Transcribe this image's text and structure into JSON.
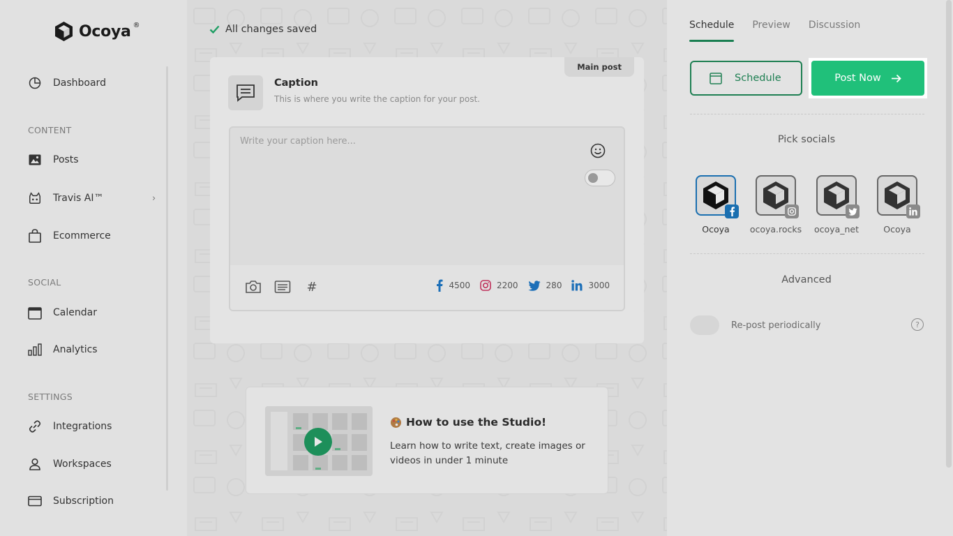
{
  "brand": {
    "name": "Ocoya",
    "reg": "®",
    "accent": "#20c07a"
  },
  "sidebar": {
    "items": [
      {
        "label": "Dashboard",
        "icon": "dashboard-icon"
      },
      {
        "label": "Posts",
        "icon": "image-icon"
      },
      {
        "label": "Travis AI™",
        "icon": "robot-icon"
      },
      {
        "label": "Ecommerce",
        "icon": "bag-icon"
      },
      {
        "label": "Calendar",
        "icon": "calendar-icon"
      },
      {
        "label": "Analytics",
        "icon": "bar-chart-icon"
      },
      {
        "label": "Integrations",
        "icon": "link-icon"
      },
      {
        "label": "Workspaces",
        "icon": "user-icon"
      },
      {
        "label": "Subscription",
        "icon": "credit-card-icon"
      }
    ],
    "sections": {
      "content": "CONTENT",
      "social": "SOCIAL",
      "settings": "SETTINGS"
    }
  },
  "editor": {
    "status": "All changes saved",
    "badge": "Main post",
    "caption_title": "Caption",
    "caption_subtitle": "This is where you write the caption for your post.",
    "caption_placeholder": "Write your caption here...",
    "limits": {
      "facebook": "4500",
      "instagram": "2200",
      "twitter": "280",
      "linkedin": "3000"
    }
  },
  "tutorial": {
    "title": "How to use the Studio!",
    "description": "Learn how to write text, create images or videos in under 1 minute"
  },
  "right_panel": {
    "tabs": [
      "Schedule",
      "Preview",
      "Discussion"
    ],
    "schedule_button": "Schedule",
    "post_now_button": "Post Now",
    "pick_socials": "Pick socials",
    "socials": [
      {
        "name": "Ocoya",
        "network": "facebook",
        "selected": true
      },
      {
        "name": "ocoya.rocks",
        "network": "instagram",
        "selected": false
      },
      {
        "name": "ocoya_net",
        "network": "twitter",
        "selected": false
      },
      {
        "name": "Ocoya",
        "network": "linkedin",
        "selected": false
      }
    ],
    "advanced": "Advanced",
    "repost_label": "Re-post periodically",
    "help": "?"
  }
}
